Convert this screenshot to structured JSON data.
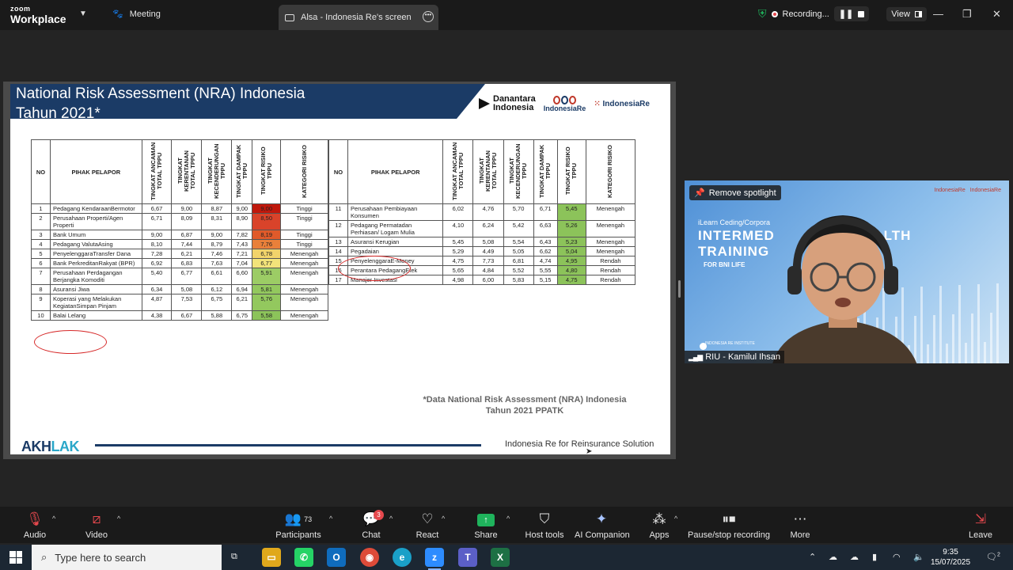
{
  "topbar": {
    "brand_top": "zoom",
    "brand_bottom": "Workplace",
    "meeting_label": "Meeting",
    "screen_tab_label": "Alsa - Indonesia Re's screen",
    "recording_label": "Recording...",
    "view_label": "View"
  },
  "slide": {
    "title_line1": "National Risk Assessment (NRA) Indonesia",
    "title_line2": "Tahun 2021*",
    "logo_danantara_1": "Danantara",
    "logo_danantara_2": "Indonesia",
    "logo_indonesiare": "IndonesiaRe",
    "logo_institute": "IndonesiaRe",
    "footnote_line1": "*Data National Risk Assessment (NRA) Indonesia",
    "footnote_line2": "Tahun 2021 PPATK",
    "akhlak_a": "AKH",
    "akhlak_b": "LAK",
    "tagline": "Indonesia Re for Reinsurance Solution",
    "headers": {
      "no": "NO",
      "pihak": "PIHAK PELAPOR",
      "ancaman": "TINGKAT ANCAMAN TOTAL TPPU",
      "kerentanan": "TINGKAT KERENTANAN TOTAL TPPU",
      "kecenderungan": "TINGKAT KECENDERUNGAN TPPU",
      "dampak": "TINGKAT DAMPAK TPPU",
      "risiko": "TINGKAT RISIKO TPPU",
      "kategori": "KATEGORI RISIKO"
    },
    "left_rows": [
      {
        "no": "1",
        "name": "Pedagang KendaraanBermotor",
        "a": "6,67",
        "b": "9,00",
        "c": "8,87",
        "d": "9,00",
        "r": "9,00",
        "cat": "Tinggi",
        "color": "#c0180c"
      },
      {
        "no": "2",
        "name": "Perusahaan Properti/Agen Properti",
        "a": "6,71",
        "b": "8,09",
        "c": "8,31",
        "d": "8,90",
        "r": "8,50",
        "cat": "Tinggi",
        "color": "#d9432a"
      },
      {
        "no": "3",
        "name": "Bank Umum",
        "a": "9,00",
        "b": "6,87",
        "c": "9,00",
        "d": "7,82",
        "r": "8,19",
        "cat": "Tinggi",
        "color": "#e05a2a"
      },
      {
        "no": "4",
        "name": "Pedagang ValutaAsing",
        "a": "8,10",
        "b": "7,44",
        "c": "8,79",
        "d": "7,43",
        "r": "7,76",
        "cat": "Tinggi",
        "color": "#e9803a"
      },
      {
        "no": "5",
        "name": "PenyelenggaraTransfer Dana",
        "a": "7,28",
        "b": "6,21",
        "c": "7,46",
        "d": "7,21",
        "r": "6,78",
        "cat": "Menengah",
        "color": "#f2d36b"
      },
      {
        "no": "6",
        "name": "Bank PerkreditanRakyat (BPR)",
        "a": "6,92",
        "b": "6,83",
        "c": "7,63",
        "d": "7,04",
        "r": "6,77",
        "cat": "Menengah",
        "color": "#f2e37a"
      },
      {
        "no": "7",
        "name": "Perusahaan Perdagangan Berjangka Komoditi",
        "a": "5,40",
        "b": "6,77",
        "c": "6,61",
        "d": "6,60",
        "r": "5,91",
        "cat": "Menengah",
        "color": "#9ccc65"
      },
      {
        "no": "8",
        "name": "Asuransi Jiwa",
        "a": "6,34",
        "b": "5,08",
        "c": "6,12",
        "d": "6,94",
        "r": "5,81",
        "cat": "Menengah",
        "color": "#93c85e"
      },
      {
        "no": "9",
        "name": "Koperasi yang Melakukan KegiatanSimpan Pinjam",
        "a": "4,87",
        "b": "7,53",
        "c": "6,75",
        "d": "6,21",
        "r": "5,76",
        "cat": "Menengah",
        "color": "#93c85e"
      },
      {
        "no": "10",
        "name": "Balai Lelang",
        "a": "4,38",
        "b": "6,67",
        "c": "5,88",
        "d": "6,75",
        "r": "5,58",
        "cat": "Menengah",
        "color": "#8cc35a"
      }
    ],
    "right_rows": [
      {
        "no": "11",
        "name": "Perusahaan Pembiayaan Konsumen",
        "a": "6,02",
        "b": "4,76",
        "c": "5,70",
        "d": "6,71",
        "r": "5,45",
        "cat": "Menengah",
        "color": "#8cc35a"
      },
      {
        "no": "12",
        "name": "Pedagang Permatadan Perhiasan/ Logam Mulia",
        "a": "4,10",
        "b": "6,24",
        "c": "5,42",
        "d": "6,63",
        "r": "5,26",
        "cat": "Menengah",
        "color": "#8cc35a"
      },
      {
        "no": "13",
        "name": "Asuransi Kerugian",
        "a": "5,45",
        "b": "5,08",
        "c": "5,54",
        "d": "6,43",
        "r": "5,23",
        "cat": "Menengah",
        "color": "#8cc35a"
      },
      {
        "no": "14",
        "name": "Pegadaian",
        "a": "5,29",
        "b": "4,49",
        "c": "5,05",
        "d": "6,62",
        "r": "5,04",
        "cat": "Menengah",
        "color": "#8cc35a"
      },
      {
        "no": "15",
        "name": "PenyelenggaraE-Money",
        "a": "4,75",
        "b": "7,73",
        "c": "6,81",
        "d": "4,74",
        "r": "4,95",
        "cat": "Rendah",
        "color": "#8cc35a"
      },
      {
        "no": "16",
        "name": "Perantara PedagangEfek",
        "a": "5,65",
        "b": "4,84",
        "c": "5,52",
        "d": "5,55",
        "r": "4,80",
        "cat": "Rendah",
        "color": "#8cc35a"
      },
      {
        "no": "17",
        "name": "Manajer Investasi",
        "a": "4,98",
        "b": "6,00",
        "c": "5,83",
        "d": "5,15",
        "r": "4,75",
        "cat": "Rendah",
        "color": "#8cc35a"
      }
    ]
  },
  "video": {
    "spotlight_button": "Remove spotlight",
    "participant_name": "RIU - Kamilul Ihsan",
    "banner_small": "iLearn Ceding/Corpora",
    "banner_big1": "INTERMED",
    "banner_big1b": "D HEALTH",
    "banner_big2": "TRAINING",
    "banner_tag": "FOR BNI LIFE",
    "banner_footer": "INDONESIA RE INSTITUTE",
    "logo1": "IndonesiaRe",
    "logo2": "IndonesiaRe"
  },
  "toolbar": {
    "audio": "Audio",
    "video": "Video",
    "participants": "Participants",
    "participants_count": "73",
    "chat": "Chat",
    "chat_badge": "3",
    "react": "React",
    "share": "Share",
    "host_tools": "Host tools",
    "ai_companion": "AI Companion",
    "apps": "Apps",
    "pause_recording": "Pause/stop recording",
    "more": "More",
    "leave": "Leave"
  },
  "taskbar": {
    "search_placeholder": "Type here to search",
    "time": "9:35",
    "date": "15/07/2025",
    "notif_count": "2"
  }
}
